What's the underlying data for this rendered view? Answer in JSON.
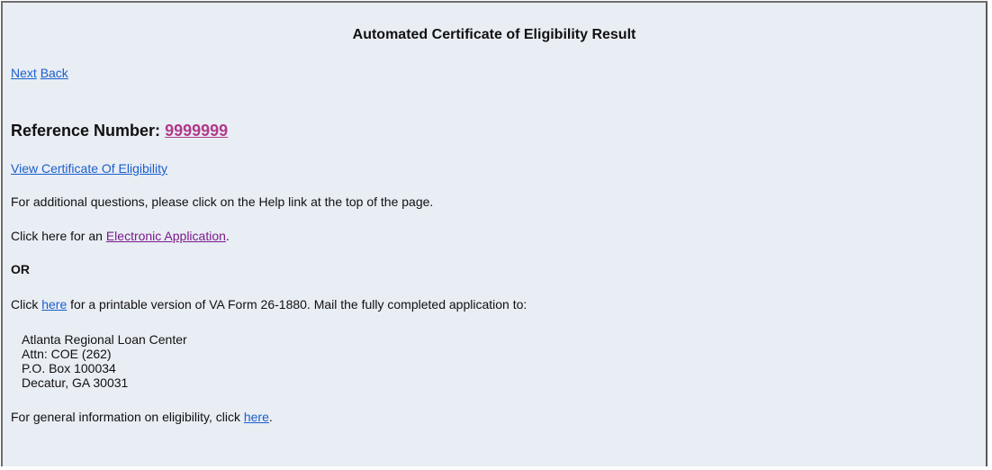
{
  "page": {
    "title": "Automated Certificate of Eligibility Result"
  },
  "nav": {
    "next_label": "Next",
    "back_label": "Back"
  },
  "reference": {
    "label": "Reference Number:",
    "number": "9999999"
  },
  "links": {
    "view_coe": "View Certificate Of Eligibility"
  },
  "help_text": "For additional questions, please click on the Help link at the top of the page.",
  "electronic": {
    "prefix": "Click here for an ",
    "link_label": "Electronic Application",
    "suffix": "."
  },
  "or_label": "OR",
  "printable": {
    "prefix": "Click ",
    "link_label": "here",
    "suffix": " for a printable version of VA Form 26-1880. Mail the fully completed application to:"
  },
  "address": {
    "line1": "Atlanta Regional Loan Center",
    "line2": "Attn: COE (262)",
    "line3": "P.O. Box 100034",
    "line4": "Decatur, GA 30031"
  },
  "general": {
    "prefix": "For general information on eligibility, click ",
    "link_label": "here",
    "suffix": "."
  },
  "colors": {
    "background": "#e9edf4",
    "link": "#1a5fcc",
    "visited_link": "#7b1a8c",
    "reference_number": "#b03a8a"
  }
}
